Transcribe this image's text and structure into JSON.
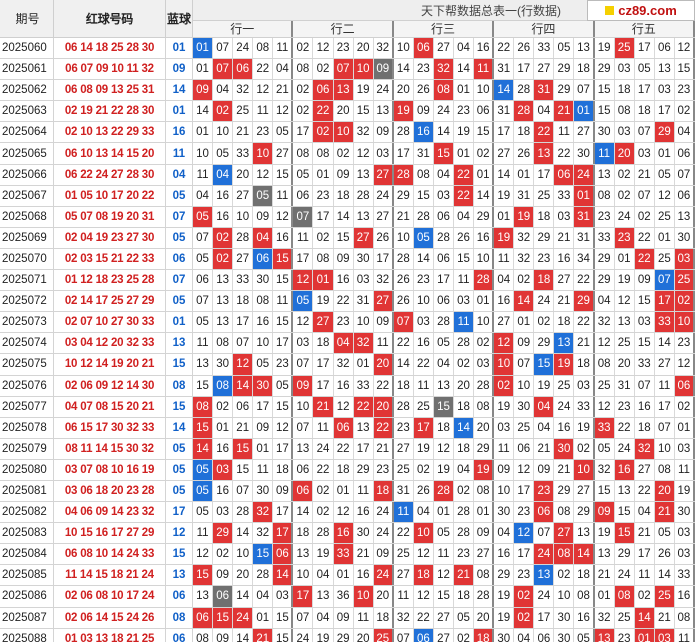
{
  "header": {
    "period": "期号",
    "red": "红球号码",
    "blue": "蓝球",
    "title": "天下帮数据总表一(行数据)",
    "groups": [
      "行一",
      "行二",
      "行三",
      "行四",
      "行五"
    ]
  },
  "watermark": "cz89.com",
  "colors": {
    "red": "#e03535",
    "blue": "#2070d8",
    "gray": "#707070"
  },
  "rows": [
    {
      "period": "2025060",
      "red": "06 14 18 25 28 30",
      "blue": "01",
      "cells": [
        "01b",
        "07",
        "24",
        "08",
        "11",
        "02",
        "12",
        "23",
        "20",
        "32",
        "10",
        "06r",
        "27",
        "04",
        "16",
        "22",
        "26",
        "33",
        "05",
        "13",
        "19",
        "25r",
        "17",
        "06",
        "12"
      ]
    },
    {
      "period": "2025061",
      "red": "06 07 09 10 11 32",
      "blue": "09",
      "cells": [
        "01",
        "07r",
        "06r",
        "22",
        "04",
        "08",
        "02",
        "07r",
        "10r",
        "09g",
        "14",
        "23",
        "32r",
        "14",
        "11r",
        "31",
        "17",
        "27",
        "29",
        "18",
        "29",
        "03",
        "05",
        "13",
        "15"
      ]
    },
    {
      "period": "2025062",
      "red": "06 08 09 13 25 31",
      "blue": "14",
      "cells": [
        "09r",
        "04",
        "32",
        "12",
        "21",
        "02",
        "06r",
        "13r",
        "19",
        "24",
        "20",
        "26",
        "08r",
        "01",
        "10",
        "14b",
        "28",
        "31r",
        "29",
        "07",
        "15",
        "18",
        "17",
        "03",
        "23"
      ]
    },
    {
      "period": "2025063",
      "red": "02 19 21 22 28 30",
      "blue": "01",
      "cells": [
        "14",
        "02r",
        "25",
        "11",
        "12",
        "02",
        "22r",
        "20",
        "15",
        "13",
        "19r",
        "09",
        "24",
        "23",
        "06",
        "31",
        "28r",
        "04",
        "21r",
        "01b",
        "15",
        "08",
        "18",
        "17",
        "02"
      ]
    },
    {
      "period": "2025064",
      "red": "02 10 13 22 29 33",
      "blue": "16",
      "cells": [
        "01",
        "10",
        "21",
        "23",
        "05",
        "17",
        "02r",
        "10r",
        "32",
        "09",
        "28",
        "16b",
        "14",
        "19",
        "15",
        "17",
        "18",
        "22r",
        "11",
        "27",
        "30",
        "03",
        "07",
        "29r",
        "04"
      ]
    },
    {
      "period": "2025065",
      "red": "06 10 13 14 15 20",
      "blue": "11",
      "cells": [
        "10",
        "05",
        "33",
        "10r",
        "27",
        "08",
        "08",
        "02",
        "12",
        "03",
        "17",
        "31",
        "15r",
        "01",
        "02",
        "27",
        "26",
        "13r",
        "22",
        "30",
        "11b",
        "20r",
        "03",
        "01",
        "06"
      ]
    },
    {
      "period": "2025066",
      "red": "06 22 24 27 28 30",
      "blue": "04",
      "cells": [
        "11",
        "04b",
        "20",
        "12",
        "15",
        "05",
        "01",
        "09",
        "13",
        "27r",
        "28r",
        "08",
        "04",
        "22r",
        "01",
        "14",
        "01",
        "17",
        "06r",
        "24r",
        "13",
        "02",
        "21",
        "05",
        "07"
      ]
    },
    {
      "period": "2025067",
      "red": "01 05 10 17 20 22",
      "blue": "05",
      "cells": [
        "04",
        "16",
        "27",
        "05g",
        "11",
        "06",
        "23",
        "18",
        "28",
        "24",
        "29",
        "15",
        "03",
        "22r",
        "14",
        "19",
        "31",
        "25",
        "33",
        "01r",
        "08",
        "02",
        "07",
        "12",
        "06"
      ]
    },
    {
      "period": "2025068",
      "red": "05 07 08 19 20 31",
      "blue": "07",
      "cells": [
        "05r",
        "16",
        "10",
        "09",
        "12",
        "07g",
        "17",
        "14",
        "13",
        "27",
        "21",
        "28",
        "06",
        "04",
        "29",
        "01",
        "19r",
        "18",
        "03",
        "31r",
        "23",
        "24",
        "02",
        "25",
        "13"
      ]
    },
    {
      "period": "2025069",
      "red": "02 04 19 23 27 30",
      "blue": "05",
      "cells": [
        "07",
        "02r",
        "28",
        "04r",
        "16",
        "11",
        "02",
        "15",
        "27r",
        "26",
        "10",
        "05b",
        "28",
        "26",
        "16",
        "19r",
        "32",
        "29",
        "21",
        "31",
        "33",
        "23r",
        "22",
        "01",
        "30"
      ]
    },
    {
      "period": "2025070",
      "red": "02 03 15 21 22 33",
      "blue": "06",
      "cells": [
        "05",
        "02r",
        "27",
        "06b",
        "15r",
        "17",
        "08",
        "09",
        "30",
        "17",
        "28",
        "14",
        "06",
        "15",
        "10",
        "11",
        "32",
        "23",
        "16",
        "34",
        "29",
        "01",
        "22r",
        "25",
        "03r"
      ]
    },
    {
      "period": "2025071",
      "red": "01 12 18 23 25 28",
      "blue": "07",
      "cells": [
        "06",
        "13",
        "33",
        "30",
        "15",
        "12r",
        "01r",
        "16",
        "03",
        "32",
        "26",
        "23",
        "17",
        "11",
        "28r",
        "04",
        "02",
        "18r",
        "27",
        "22",
        "29",
        "19",
        "09",
        "07b",
        "25r"
      ]
    },
    {
      "period": "2025072",
      "red": "02 14 17 25 27 29",
      "blue": "05",
      "cells": [
        "07",
        "13",
        "18",
        "08",
        "11",
        "05b",
        "19",
        "22",
        "31",
        "27r",
        "26",
        "10",
        "06",
        "03",
        "01",
        "16",
        "14r",
        "24",
        "21",
        "29r",
        "04",
        "12",
        "15",
        "17r",
        "02r"
      ]
    },
    {
      "period": "2025073",
      "red": "02 07 10 27 30 33",
      "blue": "01",
      "cells": [
        "05",
        "13",
        "17",
        "16",
        "15",
        "12",
        "27r",
        "23",
        "10",
        "09",
        "07r",
        "03",
        "28",
        "11b",
        "10",
        "27",
        "01",
        "02",
        "18",
        "22",
        "32",
        "13",
        "03",
        "33r",
        "10r"
      ]
    },
    {
      "period": "2025074",
      "red": "03 04 12 20 32 33",
      "blue": "13",
      "cells": [
        "11",
        "08",
        "07",
        "10",
        "17",
        "03",
        "18",
        "04r",
        "32r",
        "11",
        "22",
        "16",
        "05",
        "28",
        "02",
        "12r",
        "09",
        "29",
        "13b",
        "21",
        "12",
        "25",
        "15",
        "14",
        "23"
      ]
    },
    {
      "period": "2025075",
      "red": "10 12 14 19 20 21",
      "blue": "15",
      "cells": [
        "13",
        "30",
        "12r",
        "05",
        "23",
        "07",
        "17",
        "32",
        "01",
        "20r",
        "14",
        "22",
        "04",
        "02",
        "03",
        "10r",
        "07",
        "15b",
        "19r",
        "18",
        "08",
        "20",
        "33",
        "27",
        "12"
      ]
    },
    {
      "period": "2025076",
      "red": "02 06 09 12 14 30",
      "blue": "08",
      "cells": [
        "15",
        "08b",
        "14r",
        "30r",
        "05",
        "09r",
        "17",
        "16",
        "33",
        "22",
        "18",
        "11",
        "13",
        "20",
        "28",
        "02r",
        "10",
        "19",
        "25",
        "03",
        "25",
        "31",
        "07",
        "11",
        "06r"
      ]
    },
    {
      "period": "2025077",
      "red": "04 07 08 15 20 21",
      "blue": "15",
      "cells": [
        "08r",
        "02",
        "06",
        "17",
        "15",
        "10",
        "21r",
        "12",
        "22r",
        "20r",
        "28",
        "25",
        "15g",
        "18",
        "08",
        "19",
        "30",
        "04r",
        "24",
        "33",
        "12",
        "23",
        "16",
        "17",
        "02"
      ]
    },
    {
      "period": "2025078",
      "red": "06 15 17 30 32 33",
      "blue": "14",
      "cells": [
        "15r",
        "01",
        "21",
        "09",
        "12",
        "07",
        "11",
        "06r",
        "13",
        "22r",
        "23",
        "17r",
        "18",
        "14b",
        "20",
        "03",
        "25",
        "04",
        "16",
        "19",
        "33r",
        "22",
        "18",
        "07",
        "01"
      ]
    },
    {
      "period": "2025079",
      "red": "08 11 14 15 30 32",
      "blue": "05",
      "cells": [
        "14r",
        "16",
        "15r",
        "01",
        "17",
        "13",
        "24",
        "22",
        "17",
        "21",
        "27",
        "19",
        "12",
        "18",
        "29",
        "11",
        "06",
        "21",
        "30r",
        "02",
        "05",
        "24",
        "32r",
        "10",
        "03"
      ]
    },
    {
      "period": "2025080",
      "red": "03 07 08 10 16 19",
      "blue": "05",
      "cells": [
        "05b",
        "03r",
        "15",
        "11",
        "18",
        "06",
        "22",
        "18",
        "29",
        "23",
        "25",
        "02",
        "19",
        "04",
        "19r",
        "09",
        "12",
        "09",
        "21",
        "10r",
        "32",
        "16r",
        "27",
        "08",
        "11"
      ]
    },
    {
      "period": "2025081",
      "red": "03 06 18 20 23 28",
      "blue": "05",
      "cells": [
        "05b",
        "16",
        "07",
        "30",
        "09",
        "06r",
        "02",
        "01",
        "11",
        "18r",
        "31",
        "26",
        "28r",
        "02",
        "08",
        "10",
        "17",
        "23r",
        "29",
        "27",
        "15",
        "13",
        "22",
        "20r",
        "19"
      ]
    },
    {
      "period": "2025082",
      "red": "04 06 09 14 23 32",
      "blue": "17",
      "cells": [
        "05",
        "03",
        "28",
        "32r",
        "17",
        "14",
        "02",
        "12",
        "16",
        "24",
        "11b",
        "04",
        "01",
        "28",
        "01",
        "30",
        "23",
        "06r",
        "08",
        "29",
        "09r",
        "15",
        "04",
        "21r",
        "30"
      ]
    },
    {
      "period": "2025083",
      "red": "10 15 16 17 27 29",
      "blue": "12",
      "cells": [
        "11",
        "29r",
        "14",
        "32",
        "17r",
        "18",
        "28",
        "16r",
        "30",
        "24",
        "22",
        "10r",
        "05",
        "28",
        "09",
        "04",
        "12b",
        "07",
        "27r",
        "13",
        "19",
        "15r",
        "21",
        "05",
        "03"
      ]
    },
    {
      "period": "2025084",
      "red": "06 08 10 14 24 33",
      "blue": "15",
      "cells": [
        "12",
        "02",
        "10",
        "15b",
        "06r",
        "13",
        "19",
        "33r",
        "21",
        "09",
        "25",
        "12",
        "11",
        "23",
        "27",
        "16",
        "17",
        "24r",
        "08r",
        "14r",
        "13",
        "29",
        "17",
        "26",
        "03"
      ]
    },
    {
      "period": "2025085",
      "red": "11 14 15 18 21 24",
      "blue": "13",
      "cells": [
        "15r",
        "09",
        "20",
        "28",
        "14r",
        "10",
        "04",
        "01",
        "16",
        "24r",
        "27",
        "18r",
        "12",
        "21r",
        "08",
        "29",
        "23",
        "13b",
        "02",
        "18",
        "21",
        "24",
        "11",
        "14",
        "33"
      ]
    },
    {
      "period": "2025086",
      "red": "02 06 08 10 17 24",
      "blue": "06",
      "cells": [
        "13",
        "06g",
        "14",
        "04",
        "03",
        "17r",
        "13",
        "36",
        "10r",
        "20",
        "11",
        "12",
        "15",
        "18",
        "28",
        "19",
        "02r",
        "24",
        "10",
        "08",
        "01",
        "08r",
        "02",
        "25r",
        "16"
      ]
    },
    {
      "period": "2025087",
      "red": "02 06 14 15 24 26",
      "blue": "08",
      "cells": [
        "06r",
        "15r",
        "24r",
        "01",
        "15",
        "07",
        "04",
        "09",
        "11",
        "18",
        "32",
        "22",
        "27",
        "05",
        "20",
        "19",
        "02r",
        "17",
        "30",
        "16",
        "32",
        "25",
        "14r",
        "21",
        "08"
      ]
    },
    {
      "period": "2025088",
      "red": "01 03 13 18 21 25",
      "blue": "06",
      "cells": [
        "08",
        "09",
        "14",
        "21r",
        "15",
        "24",
        "19",
        "29",
        "20",
        "25r",
        "07",
        "06b",
        "27",
        "02",
        "18r",
        "30",
        "04",
        "06",
        "30",
        "05",
        "13r",
        "23",
        "01r",
        "03r",
        "11"
      ]
    },
    {
      "period": "2025089",
      "red": "",
      "blue": "",
      "cells": [
        "06",
        "07",
        "21",
        "09",
        "11",
        "19",
        "02",
        "16",
        "14",
        "03",
        "19",
        "24",
        "07",
        "16",
        "03",
        "27",
        "09",
        "17",
        "19",
        "13",
        "21",
        "02",
        "08",
        "02",
        "05"
      ]
    }
  ]
}
